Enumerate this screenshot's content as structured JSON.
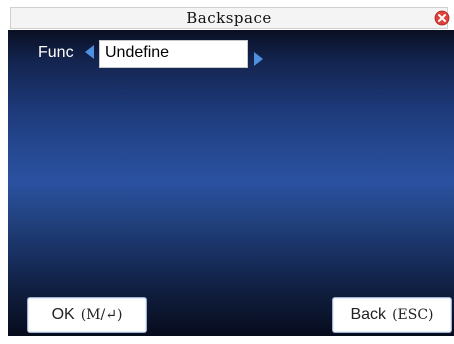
{
  "window": {
    "title": "Backspace",
    "close_icon": "close-icon",
    "close_color": "#e0403a"
  },
  "form": {
    "func_label": "Func",
    "func_value": "Undefine",
    "left_icon": "triangle-left-icon",
    "right_icon": "triangle-right-icon",
    "arrow_color": "#4f8fe0"
  },
  "buttons": {
    "ok_label": "OK",
    "ok_key": "(M/↵)",
    "back_label": "Back",
    "back_key": "(ESC)"
  }
}
